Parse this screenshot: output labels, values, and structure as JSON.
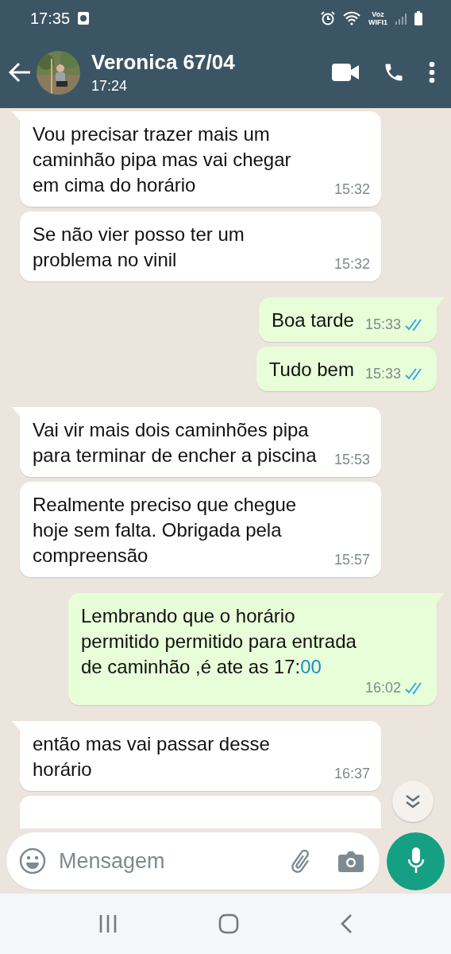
{
  "status_bar": {
    "time": "17:35",
    "network_label": "Voz\nWIFI1"
  },
  "header": {
    "contact_name": "Veronica 67/04",
    "last_seen": "17:24"
  },
  "messages": [
    {
      "kind": "text",
      "outgoing": false,
      "text": "Vou precisar trazer mais um\ncaminhão pipa mas vai chegar\nem cima do horário",
      "time": "15:32",
      "tail": true
    },
    {
      "kind": "text",
      "outgoing": false,
      "text": "Se não vier posso ter um\nproblema no vinil",
      "time": "15:32",
      "tail": false
    },
    {
      "kind": "text",
      "outgoing": true,
      "text": "Boa tarde",
      "time": "15:33",
      "read": true,
      "tail": true
    },
    {
      "kind": "text",
      "outgoing": true,
      "text": "Tudo bem",
      "time": "15:33",
      "read": true,
      "tail": false
    },
    {
      "kind": "text",
      "outgoing": false,
      "text": "Vai vir mais dois caminhões pipa\npara terminar de encher a piscina",
      "time": "15:53",
      "tail": true
    },
    {
      "kind": "text",
      "outgoing": false,
      "text": "Realmente preciso que chegue\nhoje sem falta. Obrigada pela\ncompreensão",
      "time": "15:57",
      "tail": false
    },
    {
      "kind": "text",
      "outgoing": true,
      "text": "Lembrando que o horário\npermitido permitido para entrada\nde caminhão ,é ate as 17:",
      "link": "00",
      "time": "16:02",
      "read": true,
      "tail": true
    },
    {
      "kind": "text",
      "outgoing": false,
      "text": "então mas vai passar desse\nhorário",
      "time": "16:37",
      "tail": true
    },
    {
      "kind": "clipped",
      "outgoing": false,
      "tail": false
    }
  ],
  "composer": {
    "placeholder": "Mensagem"
  }
}
